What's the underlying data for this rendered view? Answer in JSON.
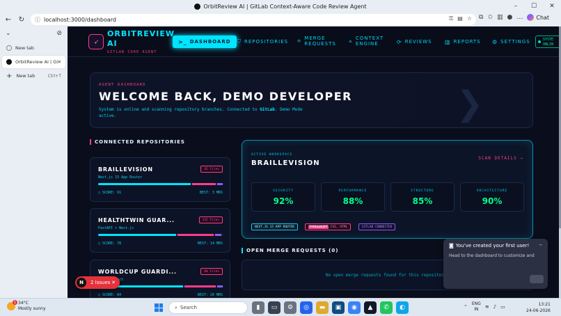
{
  "browser": {
    "window_title": "OrbitReview AI | GitLab Context-Aware Code Review Agent",
    "url": "localhost:3000/dashboard",
    "chat_label": "Chat",
    "tabs": [
      {
        "label": "New tab",
        "shortcut": ""
      },
      {
        "label": "OrbitReview AI | GitLa",
        "shortcut": ""
      },
      {
        "label": "New tab",
        "shortcut": "Ctrl+T"
      }
    ]
  },
  "app": {
    "brand_line1": "ORBITREVIEW",
    "brand_line2": "AI",
    "brand_sub": "GITLAB CORE AGENT",
    "nav": [
      {
        "label": "DASHBOARD",
        "icon": "terminal-icon"
      },
      {
        "label": "REPOSITORIES",
        "icon": "shield-icon"
      },
      {
        "label1": "MERGE",
        "label2": "REQUESTS",
        "icon": "merge-icon"
      },
      {
        "label1": "CONTEXT",
        "label2": "ENGINE",
        "icon": "context-icon"
      },
      {
        "label": "REVIEWS",
        "icon": "refresh-icon"
      },
      {
        "label": "REPORTS",
        "icon": "bar-chart-icon"
      },
      {
        "label": "SETTINGS",
        "icon": "gear-icon"
      }
    ],
    "status_line1": "SYSTE",
    "status_line2": "ONLIN"
  },
  "hero": {
    "eyebrow": "AGENT DASHBOARD",
    "title": "WELCOME BACK, DEMO DEVELOPER",
    "desc_pre": "System is online and scanning repository branches. Connected to ",
    "desc_bold": "GitLab",
    "desc_post": ". Demo Mode active."
  },
  "repos": {
    "section_title": "CONNECTED REPOSITORIES",
    "items": [
      {
        "name": "BRAILLEVISION",
        "stack": "Next.js 15 App Router",
        "files": "45 Files",
        "score": "SCORE: 91",
        "best": "BEST: 3 MRS",
        "bar": [
          0.74,
          0.19,
          0.04
        ]
      },
      {
        "name": "HEALTHTWIN GUAR...",
        "stack": "FastAPI + Next.js",
        "files": "132 Files",
        "score": "SCORE: 78",
        "best": "BEST: 14 MRS",
        "bar": [
          0.62,
          0.29,
          0.05
        ]
      },
      {
        "name": "WORLDCUP GUARDI...",
        "stack": "Node + React",
        "files": "80 Files",
        "score": "SCORE: 84",
        "best": "BEST: 26 MRS",
        "bar": [
          0.68,
          0.25,
          0.04
        ]
      }
    ]
  },
  "workspace": {
    "eyebrow": "ACTIVE WORKSPACE",
    "name": "BRAILLEVISION",
    "scan_label": "SCAN DETAILS →",
    "metrics": [
      {
        "label": "SECURITY",
        "value": "92%"
      },
      {
        "label": "PERFORMANCE",
        "value": "88%"
      },
      {
        "label": "STRUCTURE",
        "value": "85%"
      },
      {
        "label": "ARCHITECTURE",
        "value": "90%"
      }
    ],
    "tag1": "NEXT.JS 15 APP ROUTER",
    "tag2_bold": "TYPESCRIPT",
    "tag2_rest": " CSS, HTML",
    "tag3": "GITLAB CONNECTED"
  },
  "merge_requests": {
    "title": "OPEN MERGE REQUESTS (0)",
    "empty": "No open merge requests found for this repository."
  },
  "toast": {
    "title": "You've created your first user!",
    "body": "Head to the dashboard to customize and"
  },
  "issues": {
    "badge": "N",
    "label": "2 Issues"
  },
  "taskbar": {
    "temp": "34°C",
    "weather": "Mostly sunny",
    "weather_badge": "1",
    "search_placeholder": "Search",
    "lang1": "ENG",
    "lang2": "IN",
    "time": "13:21",
    "date": "24-06-2026"
  },
  "colors": {
    "accent_cyan": "#00e5ff",
    "accent_pink": "#ff3d8b",
    "accent_green": "#00ff8c",
    "accent_purple": "#8b5cf6",
    "background": "#0a0e1c"
  }
}
